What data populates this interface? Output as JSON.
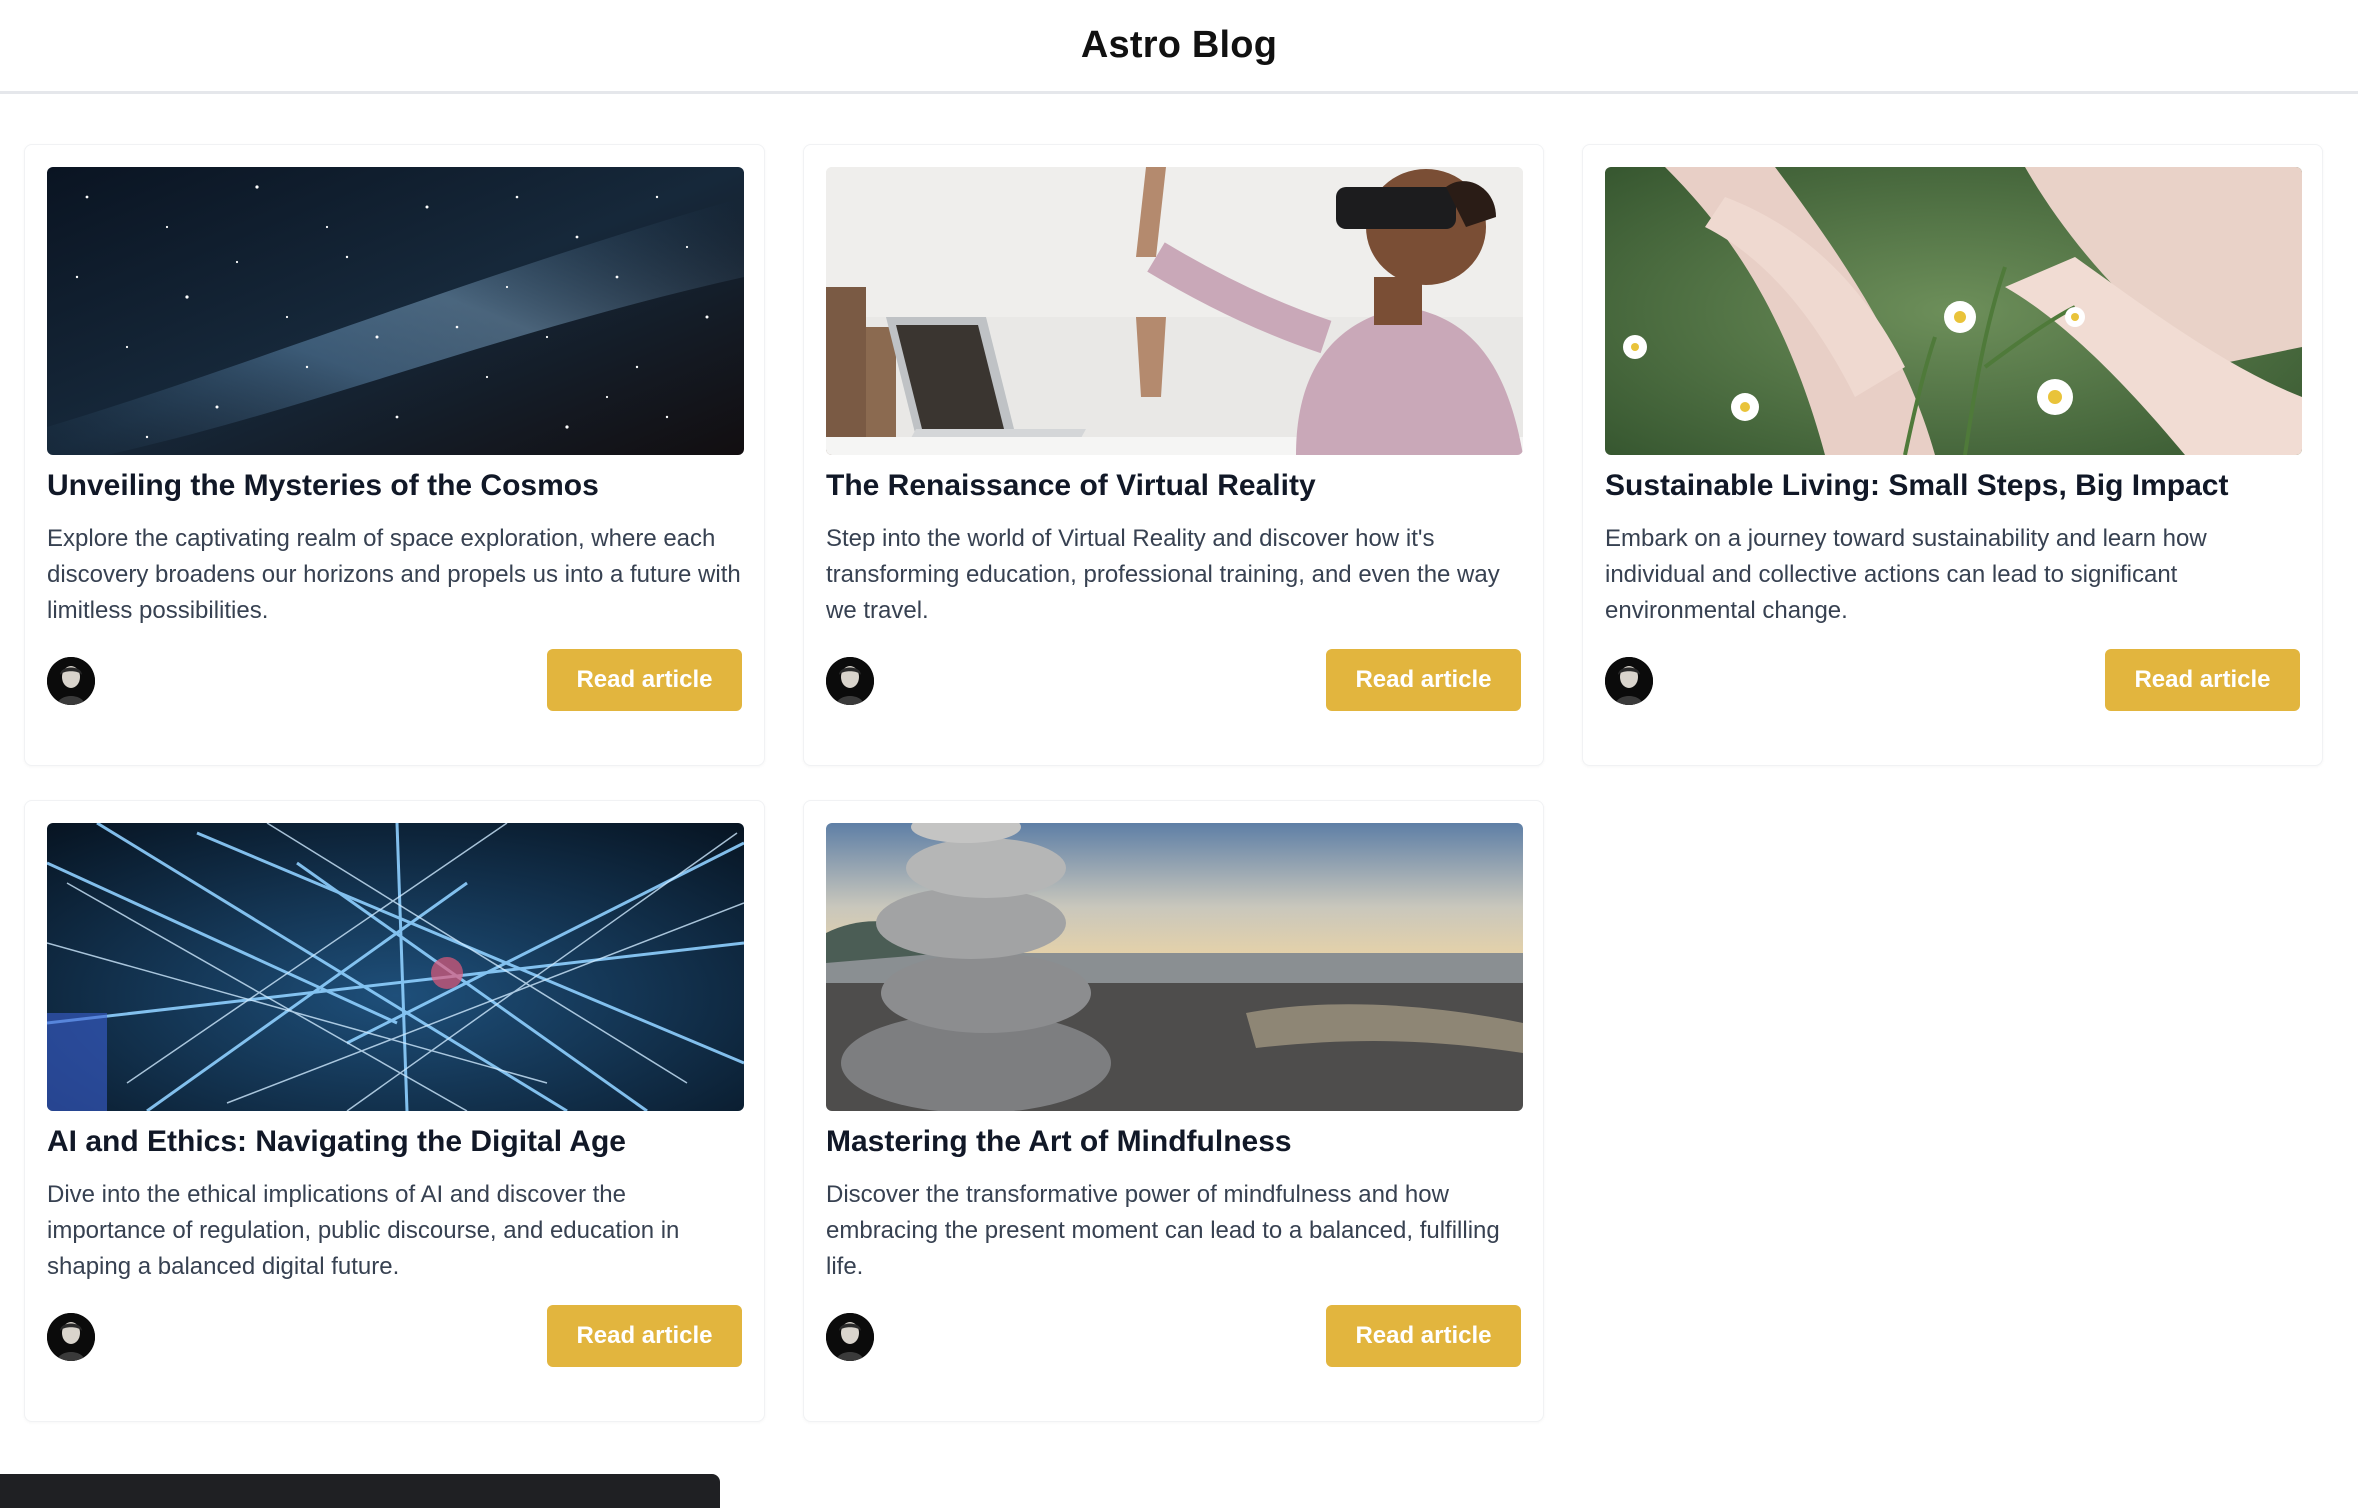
{
  "header": {
    "title": "Astro Blog"
  },
  "accent_color": "#e2b53e",
  "posts": [
    {
      "title": "Unveiling the Mysteries of the Cosmos",
      "description": "Explore the captivating realm of space exploration, where each discovery broadens our horizons and propels us into a future with limitless possibilities.",
      "image": "milky-way-night-sky",
      "button_label": "Read article"
    },
    {
      "title": "The Renaissance of Virtual Reality",
      "description": "Step into the world of Virtual Reality and discover how it's transforming education, professional training, and even the way we travel.",
      "image": "woman-wearing-vr-headset",
      "button_label": "Read article"
    },
    {
      "title": "Sustainable Living: Small Steps, Big Impact",
      "description": "Embark on a journey toward sustainability and learn how individual and collective actions can lead to significant environmental change.",
      "image": "hands-with-daisy-flowers",
      "button_label": "Read article"
    },
    {
      "title": "AI and Ethics: Navigating the Digital Age",
      "description": "Dive into the ethical implications of AI and discover the importance of regulation, public discourse, and education in shaping a balanced digital future.",
      "image": "blue-neural-network-lines",
      "button_label": "Read article"
    },
    {
      "title": "Mastering the Art of Mindfulness",
      "description": "Discover the transformative power of mindfulness and how embracing the present moment can lead to a balanced, fulfilling life.",
      "image": "stacked-stones-on-shore",
      "button_label": "Read article"
    }
  ]
}
